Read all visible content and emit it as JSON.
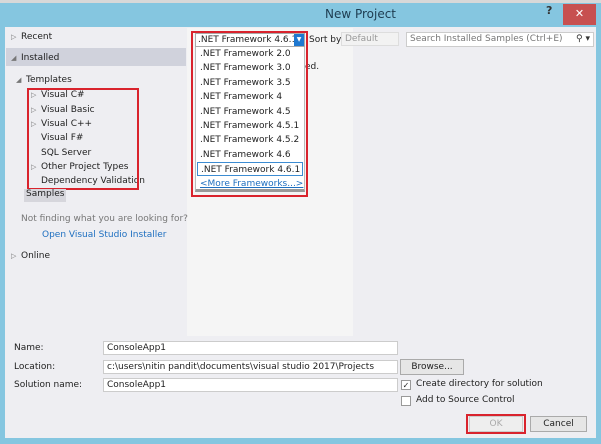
{
  "window": {
    "title": "New Project",
    "help": "?",
    "close": "✕"
  },
  "left": {
    "recent": "Recent",
    "installed": "Installed",
    "templates": "Templates",
    "template_items": [
      "Visual C#",
      "Visual Basic",
      "Visual C++",
      "Visual F#",
      "SQL Server",
      "Other Project Types",
      "Dependency Validation"
    ],
    "samples": "Samples",
    "not_finding": "Not finding what you are looking for?",
    "installer_link": "Open Visual Studio Installer",
    "online": "Online"
  },
  "framework": {
    "selected": ".NET Framework 4.6.1",
    "options": [
      ".NET Framework 2.0",
      ".NET Framework 3.0",
      ".NET Framework 3.5",
      ".NET Framework 4",
      ".NET Framework 4.5",
      ".NET Framework 4.5.1",
      ".NET Framework 4.5.2",
      ".NET Framework 4.6",
      ".NET Framework 4.6.1"
    ],
    "more": "<More Frameworks...>"
  },
  "middle": {
    "message_fragment": "lled."
  },
  "sort": {
    "label": "Sort by:",
    "value": "Default"
  },
  "search": {
    "placeholder": "Search Installed Samples (Ctrl+E)"
  },
  "form": {
    "name_label": "Name:",
    "name": "ConsoleApp1",
    "location_label": "Location:",
    "location": "c:\\users\\nitin pandit\\documents\\visual studio 2017\\Projects",
    "solution_label": "Solution name:",
    "solution": "ConsoleApp1",
    "browse": "Browse...",
    "create_dir": "Create directory for solution",
    "create_dir_checked": true,
    "source_control": "Add to Source Control",
    "source_control_checked": false,
    "ok": "OK",
    "cancel": "Cancel"
  }
}
